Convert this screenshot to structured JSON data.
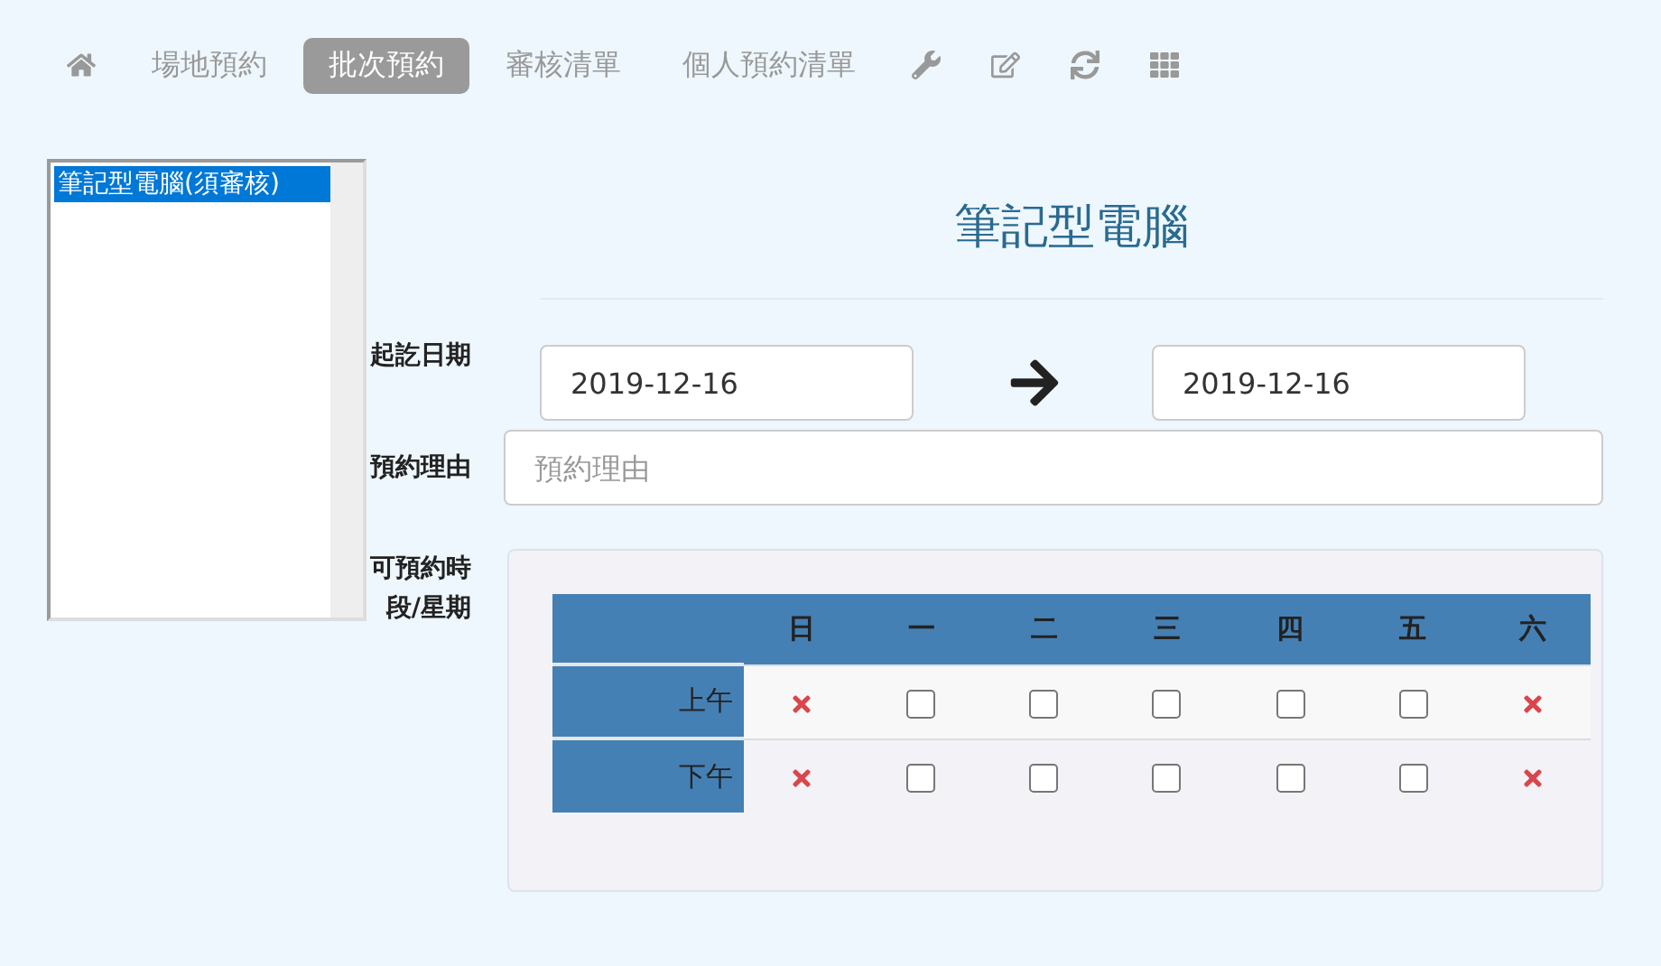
{
  "nav": [
    {
      "kind": "home",
      "selected": false
    },
    {
      "kind": "text",
      "label": "場地預約",
      "selected": false
    },
    {
      "kind": "text",
      "label": "批次預約",
      "selected": true
    },
    {
      "kind": "text",
      "label": "審核清單",
      "selected": false
    },
    {
      "kind": "text",
      "label": "個人預約清單",
      "selected": false
    },
    {
      "kind": "wrench",
      "selected": false
    },
    {
      "kind": "edit",
      "selected": false
    },
    {
      "kind": "refresh",
      "selected": false
    },
    {
      "kind": "grid",
      "selected": false
    }
  ],
  "resource_list": {
    "items": [
      {
        "label": "筆記型電腦(須審核)",
        "selected": true
      }
    ]
  },
  "title": "筆記型電腦",
  "date_range": {
    "label": "起訖日期",
    "start": "2019-12-16",
    "end": "2019-12-16"
  },
  "reason": {
    "label": "預約理由",
    "placeholder": "預約理由"
  },
  "timeslots": {
    "label": "可預約時段/星期",
    "days": [
      "日",
      "一",
      "二",
      "三",
      "四",
      "五",
      "六"
    ],
    "rows": [
      {
        "label": "上午",
        "cells": [
          {
            "kind": "unavailable"
          },
          {
            "kind": "checkbox",
            "checked": false
          },
          {
            "kind": "checkbox",
            "checked": false
          },
          {
            "kind": "checkbox",
            "checked": false
          },
          {
            "kind": "checkbox",
            "checked": false
          },
          {
            "kind": "checkbox",
            "checked": false
          },
          {
            "kind": "unavailable"
          }
        ]
      },
      {
        "label": "下午",
        "cells": [
          {
            "kind": "unavailable"
          },
          {
            "kind": "checkbox",
            "checked": false
          },
          {
            "kind": "checkbox",
            "checked": false
          },
          {
            "kind": "checkbox",
            "checked": false
          },
          {
            "kind": "checkbox",
            "checked": false
          },
          {
            "kind": "checkbox",
            "checked": false
          },
          {
            "kind": "unavailable"
          }
        ]
      }
    ]
  }
}
